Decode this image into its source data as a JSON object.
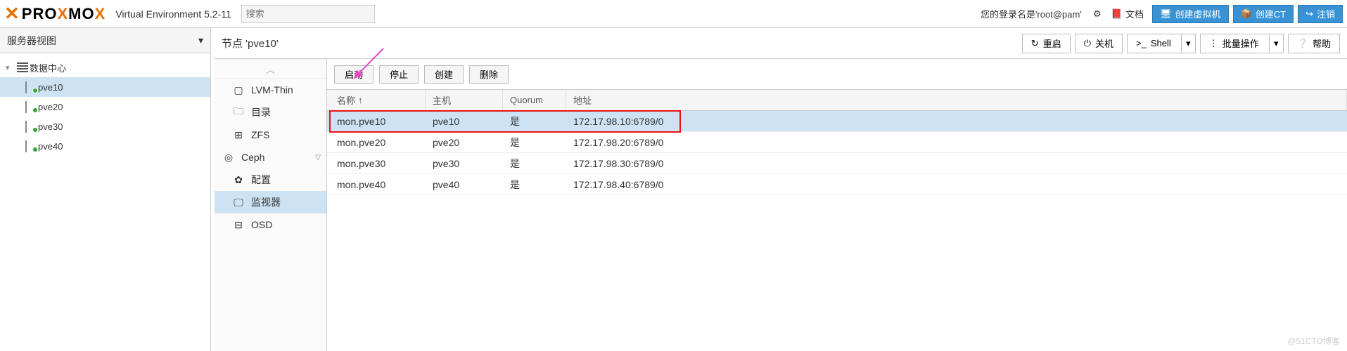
{
  "header": {
    "logo_text_1": "PRO",
    "logo_text_2": "X",
    "logo_text_3": "MO",
    "logo_text_4": "X",
    "env": "Virtual Environment 5.2-11",
    "search_placeholder": "搜索",
    "login_label": "您的登录名是'root@pam'",
    "docs": "文档",
    "create_vm": "创建虚拟机",
    "create_ct": "创建CT",
    "logout": "注销"
  },
  "left": {
    "view_label": "服务器视图",
    "root": "数据中心",
    "nodes": [
      "pve10",
      "pve20",
      "pve30",
      "pve40"
    ],
    "selected": "pve10"
  },
  "main": {
    "title": "节点 'pve10'",
    "buttons": {
      "reboot": "重启",
      "shutdown": "关机",
      "shell": "Shell",
      "bulk": "批量操作",
      "help": "帮助"
    }
  },
  "subnav": {
    "items": [
      {
        "label": "LVM-Thin",
        "icon": "▢"
      },
      {
        "label": "目录",
        "icon": "folder"
      },
      {
        "label": "ZFS",
        "icon": "grid"
      },
      {
        "label": "Ceph",
        "icon": "ceph",
        "group": true
      },
      {
        "label": "配置",
        "icon": "gear"
      },
      {
        "label": "监视器",
        "icon": "monitor",
        "selected": true
      },
      {
        "label": "OSD",
        "icon": "disk"
      }
    ]
  },
  "toolbar": {
    "start": "启动",
    "stop": "停止",
    "create": "创建",
    "delete": "删除"
  },
  "grid": {
    "headers": {
      "name": "名称",
      "host": "主机",
      "quorum": "Quorum",
      "addr": "地址"
    },
    "rows": [
      {
        "name": "mon.pve10",
        "host": "pve10",
        "quorum": "是",
        "addr": "172.17.98.10:6789/0",
        "selected": true
      },
      {
        "name": "mon.pve20",
        "host": "pve20",
        "quorum": "是",
        "addr": "172.17.98.20:6789/0"
      },
      {
        "name": "mon.pve30",
        "host": "pve30",
        "quorum": "是",
        "addr": "172.17.98.30:6789/0"
      },
      {
        "name": "mon.pve40",
        "host": "pve40",
        "quorum": "是",
        "addr": "172.17.98.40:6789/0"
      }
    ]
  },
  "watermark": "@51CTO博客"
}
